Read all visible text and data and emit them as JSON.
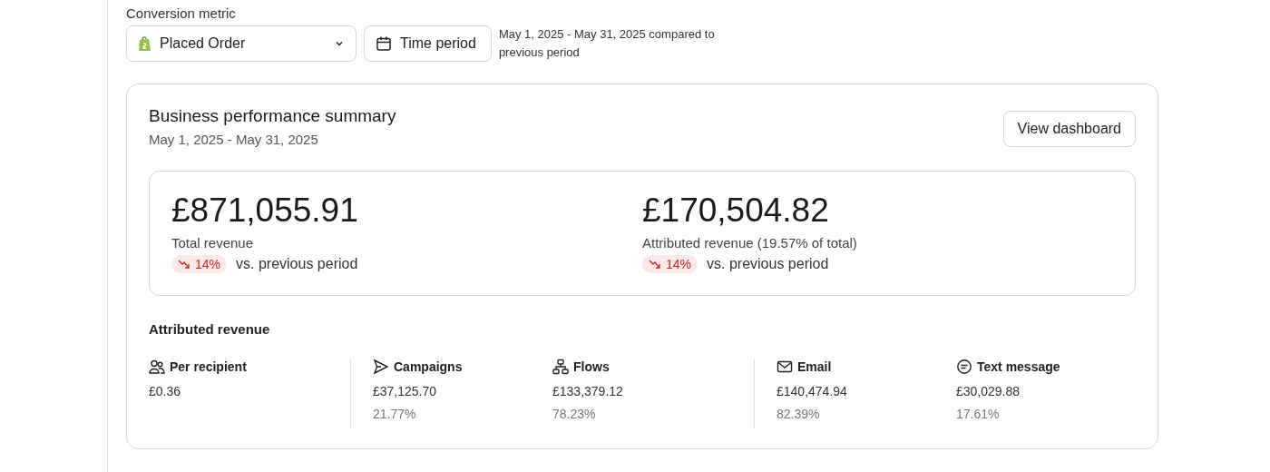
{
  "filters": {
    "label": "Conversion metric",
    "metric": "Placed Order",
    "time_button": "Time period",
    "range_note": "May 1, 2025 - May 31, 2025 compared to previous period"
  },
  "summary": {
    "title": "Business performance summary",
    "subtitle": "May 1, 2025 - May 31, 2025",
    "button": "View dashboard",
    "totals": [
      {
        "value": "£871,055.91",
        "label": "Total revenue",
        "change": "14%",
        "falling": true,
        "comparison": "vs. previous period"
      },
      {
        "value": "£170,504.82",
        "label": "Attributed revenue (19.57% of total)",
        "change": "14%",
        "falling": true,
        "comparison": "vs. previous period"
      }
    ],
    "attributed_title": "Attributed revenue",
    "groups": [
      [
        {
          "kind": "people",
          "label": "Per recipient",
          "value": "£0.36"
        }
      ],
      [
        {
          "kind": "send",
          "label": "Campaigns",
          "value": "£37,125.70",
          "share": "21.77%"
        },
        {
          "kind": "flow",
          "label": "Flows",
          "value": "£133,379.12",
          "share": "78.23%"
        }
      ],
      [
        {
          "kind": "mail",
          "label": "Email",
          "value": "£140,474.94",
          "share": "82.39%"
        },
        {
          "kind": "chat",
          "label": "Text message",
          "value": "£30,029.88",
          "share": "17.61%"
        }
      ]
    ]
  }
}
